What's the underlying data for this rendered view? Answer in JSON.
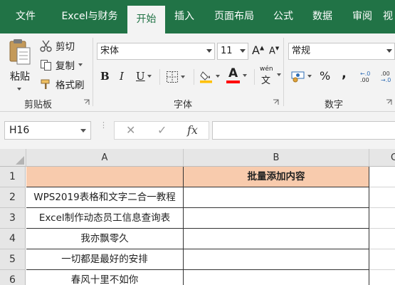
{
  "tabs": [
    {
      "label": "文件",
      "active": false
    },
    {
      "label": "Excel与财务",
      "active": false
    },
    {
      "label": "开始",
      "active": true
    },
    {
      "label": "插入",
      "active": false
    },
    {
      "label": "页面布局",
      "active": false
    },
    {
      "label": "公式",
      "active": false
    },
    {
      "label": "数据",
      "active": false
    },
    {
      "label": "审阅",
      "active": false
    },
    {
      "label": "视",
      "active": false
    }
  ],
  "clipboard": {
    "paste_label": "粘贴",
    "cut_label": "剪切",
    "copy_label": "复制",
    "format_painter_label": "格式刷",
    "group_label": "剪贴板"
  },
  "font": {
    "font_name": "宋体",
    "font_size": "11",
    "bold": "B",
    "italic": "I",
    "underline": "U",
    "grow_glyph": "A",
    "shrink_glyph": "A",
    "font_color_glyph": "A",
    "wen_glyph": "wén",
    "wen_char": "文",
    "group_label": "字体",
    "font_color": "#ff0000",
    "fill_color": "#ffc000"
  },
  "number": {
    "format": "常规",
    "percent": "%",
    "comma": ",",
    "inc_decimal_top": "←.0",
    "inc_decimal_bottom": ".00",
    "dec_decimal_top": ".00",
    "dec_decimal_bottom": "→.0",
    "group_label": "数字"
  },
  "formula_bar": {
    "name_box": "H16",
    "cancel_glyph": "✕",
    "enter_glyph": "✓",
    "fx_label": "fx",
    "formula": ""
  },
  "sheet": {
    "columns": [
      "A",
      "B",
      "C"
    ],
    "rows": [
      {
        "num": "1",
        "a": "",
        "b": "批量添加内容"
      },
      {
        "num": "2",
        "a": "WPS2019表格和文字二合一教程",
        "b": ""
      },
      {
        "num": "3",
        "a": "Excel制作动态员工信息查询表",
        "b": ""
      },
      {
        "num": "4",
        "a": "我亦飘零久",
        "b": ""
      },
      {
        "num": "5",
        "a": "一切都是最好的安排",
        "b": ""
      },
      {
        "num": "6",
        "a": "春风十里不如你",
        "b": ""
      }
    ]
  },
  "colors": {
    "ribbon_green": "#217346",
    "header_fill": "#f8cbad"
  }
}
